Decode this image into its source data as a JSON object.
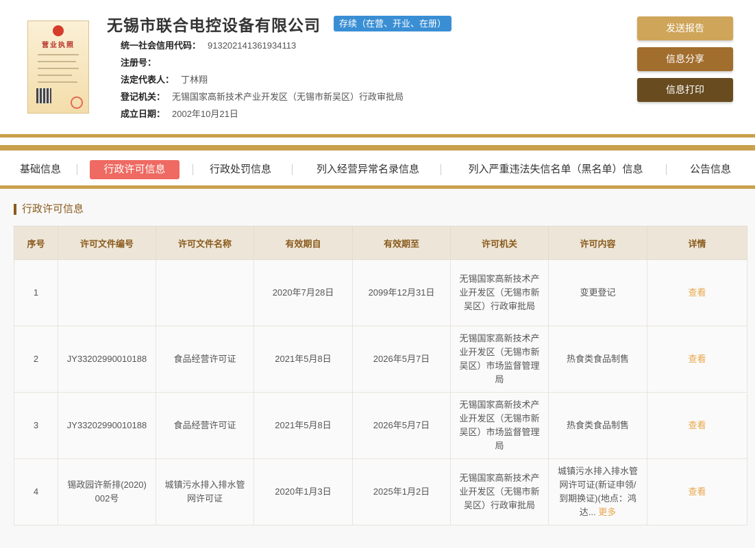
{
  "company": {
    "name": "无锡市联合电控设备有限公司",
    "status": "存续（在营、开业、在册）",
    "license_image_title": "营业执照"
  },
  "info": [
    {
      "label": "统一社会信用代码：",
      "value": "913202141361934113"
    },
    {
      "label": "注册号：",
      "value": ""
    },
    {
      "label": "法定代表人：",
      "value": "丁林翔"
    },
    {
      "label": "登记机关：",
      "value": "无锡国家高新技术产业开发区（无锡市新吴区）行政审批局"
    },
    {
      "label": "成立日期：",
      "value": "2002年10月21日"
    }
  ],
  "actions": {
    "report": "发送报告",
    "share": "信息分享",
    "print": "信息打印"
  },
  "tabs": [
    {
      "label": "基础信息",
      "active": false
    },
    {
      "label": "行政许可信息",
      "active": true
    },
    {
      "label": "行政处罚信息",
      "active": false
    },
    {
      "label": "列入经营异常名录信息",
      "active": false
    },
    {
      "label": "列入严重违法失信名单（黑名单）信息",
      "active": false
    },
    {
      "label": "公告信息",
      "active": false
    }
  ],
  "section": {
    "title": "行政许可信息"
  },
  "table": {
    "headers": [
      "序号",
      "许可文件编号",
      "许可文件名称",
      "有效期自",
      "有效期至",
      "许可机关",
      "许可内容",
      "详情"
    ],
    "rows": [
      {
        "no": "1",
        "doc_no": "",
        "doc_name": "",
        "from": "2020年7月28日",
        "to": "2099年12月31日",
        "authority": "无锡国家高新技术产业开发区（无锡市新吴区）行政审批局",
        "content": "变更登记",
        "detail": "查看",
        "more": ""
      },
      {
        "no": "2",
        "doc_no": "JY33202990010188",
        "doc_name": "食品经营许可证",
        "from": "2021年5月8日",
        "to": "2026年5月7日",
        "authority": "无锡国家高新技术产业开发区（无锡市新吴区）市场监督管理局",
        "content": "热食类食品制售",
        "detail": "查看",
        "more": ""
      },
      {
        "no": "3",
        "doc_no": "JY33202990010188",
        "doc_name": "食品经营许可证",
        "from": "2021年5月8日",
        "to": "2026年5月7日",
        "authority": "无锡国家高新技术产业开发区（无锡市新吴区）市场监督管理局",
        "content": "热食类食品制售",
        "detail": "查看",
        "more": ""
      },
      {
        "no": "4",
        "doc_no": "锡政园许新排(2020)002号",
        "doc_name": "城镇污水排入排水管网许可证",
        "from": "2020年1月3日",
        "to": "2025年1月2日",
        "authority": "无锡国家高新技术产业开发区（无锡市新吴区）行政审批局",
        "content": "城镇污水排入排水管网许可证(新证申领/到期换证)(地点：鸿达...",
        "detail": "查看",
        "more": "更多"
      }
    ]
  },
  "colors": {
    "gold": "#c9a04c",
    "active_tab": "#ee6a62",
    "badge": "#3a8fd4",
    "link": "#e8a64a"
  }
}
